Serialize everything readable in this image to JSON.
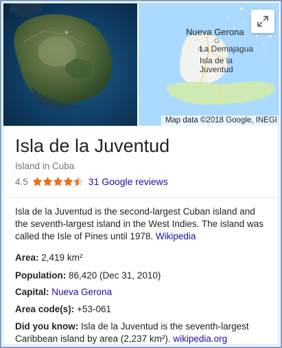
{
  "map": {
    "labels": {
      "nueva_gerona": "Nueva Gerona",
      "la_demajagua": "La Demajagua",
      "isla_line1": "Isla de la",
      "isla_line2": "Juventud"
    },
    "attribution": "Map data ©2018 Google, INEGI",
    "expand_icon": "expand-icon"
  },
  "entity": {
    "title": "Isla de la Juventud",
    "subtitle": "Island in Cuba",
    "rating": "4.5",
    "rating_stars": 4.5,
    "reviews_link": "31 Google reviews"
  },
  "description": {
    "text": "Isla de la Juventud is the second-largest Cuban island and the seventh-largest island in the West Indies. The island was called the Isle of Pines until 1978.",
    "source_link": "Wikipedia"
  },
  "facts": {
    "area_label": "Area:",
    "area_value": "2,419 km²",
    "population_label": "Population:",
    "population_value": "86,420 (Dec 31, 2010)",
    "capital_label": "Capital:",
    "capital_value": "Nueva Gerona",
    "area_code_label": "Area code(s):",
    "area_code_value": "+53-061",
    "did_you_know_label": "Did you know:",
    "did_you_know_text": "Isla de la Juventud is the seventh-largest Caribbean island by area (2,237 km²).",
    "did_you_know_link": "wikipedia.org"
  },
  "colors": {
    "link": "#1a0dab",
    "star": "#e7711b",
    "water": "#aadaff",
    "land": "#f2f2ee",
    "park": "#cfe9b4",
    "border": "#7a9fd0"
  }
}
